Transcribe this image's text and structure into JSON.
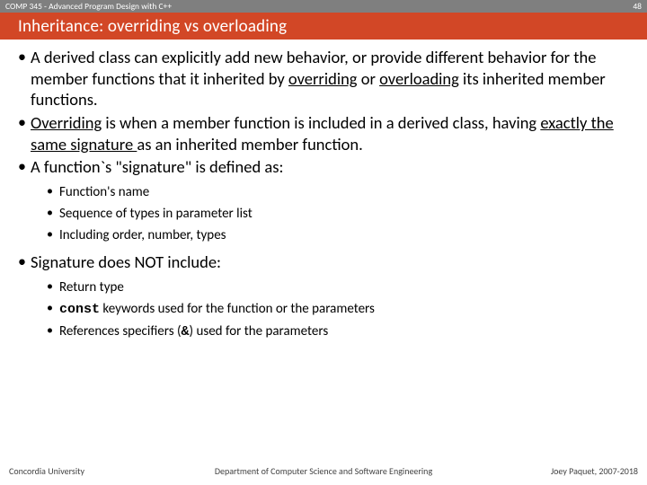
{
  "header": {
    "course": "COMP 345 - Advanced Program Design with C++",
    "page_number": "48",
    "title": "Inheritance: overriding vs overloading"
  },
  "bullets": {
    "b1_pre": "A derived class can explicitly add new behavior, or provide different behavior for the member functions that it inherited by ",
    "b1_u1": "overriding",
    "b1_mid": " or ",
    "b1_u2": "overloading",
    "b1_post": " its inherited member functions.",
    "b2_u": "Overriding",
    "b2_mid": " is when a member function is included in a derived class, having ",
    "b2_u2": "exactly the same signature ",
    "b2_post": "as an inherited member function.",
    "b3": "A function`s \"signature\" is defined as:",
    "b3_sub1": "Function's name",
    "b3_sub2": "Sequence of types in parameter list",
    "b3_sub3": "Including order, number, types",
    "b4": "Signature does NOT include:",
    "b4_sub1": "Return type",
    "b4_sub2_code": "const",
    "b4_sub2_post": " keywords used for the function or the parameters",
    "b4_sub3_pre": "References specifiers (",
    "b4_sub3_amp": "&",
    "b4_sub3_post": ") used for the parameters"
  },
  "footer": {
    "left": "Concordia University",
    "center": "Department of Computer Science and Software Engineering",
    "right": "Joey Paquet, 2007-2018"
  }
}
